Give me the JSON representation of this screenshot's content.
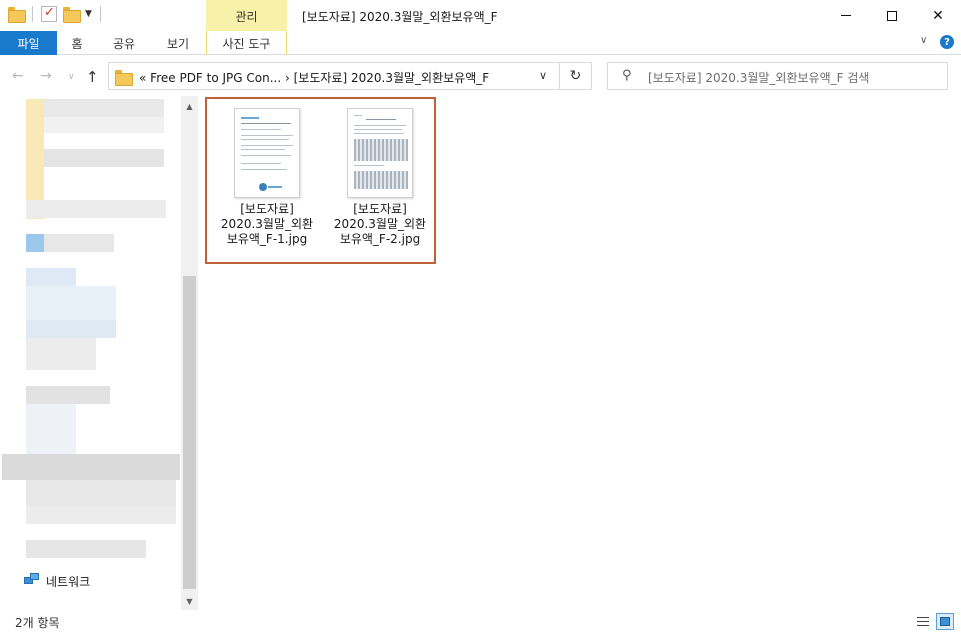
{
  "window": {
    "title": "[보도자료] 2020.3월말_외환보유액_F",
    "context_tab_group": "관리",
    "controls": {
      "minimize": "minimize",
      "maximize": "maximize",
      "close": "close"
    }
  },
  "ribbon": {
    "tabs": [
      "파일",
      "홈",
      "공유",
      "보기",
      "사진 도구"
    ]
  },
  "navigation": {
    "address": {
      "overflow": "«",
      "crumbs": [
        "Free PDF to JPG Con...",
        "[보도자료] 2020.3월말_외환보유액_F"
      ]
    },
    "search_placeholder": "[보도자료] 2020.3월말_외환보유액_F 검색"
  },
  "nav_pane": {
    "network_label": "네트워크"
  },
  "files": [
    {
      "name_line1": "[보도자료]",
      "name_line2": "2020.3월말_외환",
      "name_line3": "보유액_F-1.jpg"
    },
    {
      "name_line1": "[보도자료]",
      "name_line2": "2020.3월말_외환",
      "name_line3": "보유액_F-2.jpg"
    }
  ],
  "status": {
    "item_count": "2개 항목"
  },
  "colors": {
    "file_tab": "#1979ca",
    "context_tab": "#f7f1a9",
    "selection_border": "#c0613a"
  }
}
